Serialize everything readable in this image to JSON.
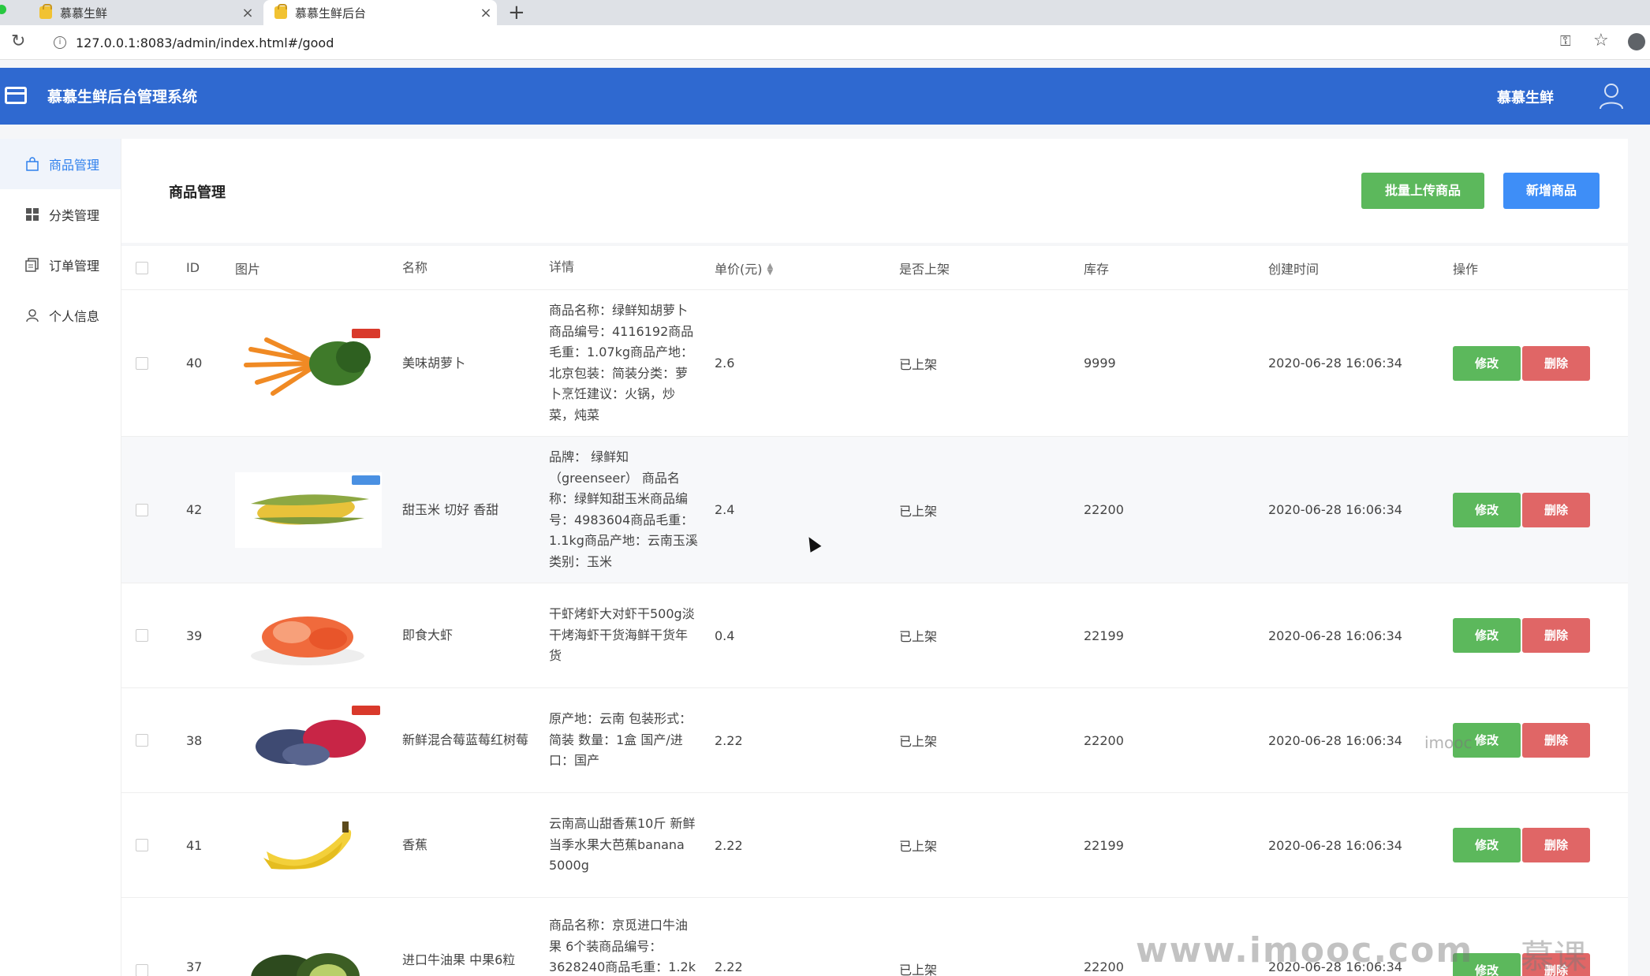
{
  "browser": {
    "tabs": [
      {
        "title": "慕慕生鲜",
        "close": "×"
      },
      {
        "title": "慕慕生鲜后台",
        "close": "×"
      }
    ],
    "new_tab": "+",
    "url": "127.0.0.1:8083/admin/index.html#/good",
    "icons": [
      "reload-icon",
      "info-icon",
      "key-icon",
      "star-icon",
      "profile-icon"
    ]
  },
  "header": {
    "title": "慕慕生鲜后台管理系统",
    "user": "慕慕生鲜",
    "color": "#2f69d0"
  },
  "sidebar": {
    "items": [
      {
        "label": "商品管理",
        "icon": "bag-icon",
        "active": true
      },
      {
        "label": "分类管理",
        "icon": "grid-icon",
        "active": false
      },
      {
        "label": "订单管理",
        "icon": "order-icon",
        "active": false
      },
      {
        "label": "个人信息",
        "icon": "user-icon",
        "active": false
      }
    ]
  },
  "main": {
    "title": "商品管理",
    "batch_upload_label": "批量上传商品",
    "new_product_label": "新增商品"
  },
  "table": {
    "columns": [
      "ID",
      "图片",
      "名称",
      "详情",
      "单价(元)",
      "是否上架",
      "库存",
      "创建时间",
      "操作"
    ],
    "edit_label": "修改",
    "delete_label": "删除",
    "rows": [
      {
        "id": "40",
        "name": "美味胡萝卜",
        "detail": "商品名称：绿鲜知胡萝卜商品编号：4116192商品毛重：1.07kg商品产地：北京包装：简装分类：萝卜烹饪建议：火锅，炒菜，炖菜",
        "price": "2.6",
        "status": "已上架",
        "stock": "9999",
        "created": "2020-06-28 16:06:34",
        "image": "carrot"
      },
      {
        "id": "42",
        "name": "甜玉米 切好 香甜",
        "detail": "品牌： 绿鲜知（greenseer） 商品名称：绿鲜知甜玉米商品编号：4983604商品毛重：1.1kg商品产地：云南玉溪类别：玉米",
        "price": "2.4",
        "status": "已上架",
        "stock": "22200",
        "created": "2020-06-28 16:06:34",
        "image": "corn"
      },
      {
        "id": "39",
        "name": "即食大虾",
        "detail": "干虾烤虾大对虾干500g淡干烤海虾干货海鲜干货年货",
        "price": "0.4",
        "status": "已上架",
        "stock": "22199",
        "created": "2020-06-28 16:06:34",
        "image": "shrimp"
      },
      {
        "id": "38",
        "name": "新鲜混合莓蓝莓红树莓",
        "detail": "原产地：云南 包装形式：简装 数量：1盒 国产/进口：国产",
        "price": "2.22",
        "status": "已上架",
        "stock": "22200",
        "created": "2020-06-28 16:06:34",
        "image": "berries"
      },
      {
        "id": "41",
        "name": "香蕉",
        "detail": "云南高山甜香蕉10斤 新鲜当季水果大芭蕉banana 5000g",
        "price": "2.22",
        "status": "已上架",
        "stock": "22199",
        "created": "2020-06-28 16:06:34",
        "image": "banana"
      },
      {
        "id": "37",
        "name": "进口牛油果 中果6粒",
        "detail": "商品名称：京觅进口牛油果 6个装商品编号：3628240商品毛重：1.2k",
        "price": "2.22",
        "status": "已上架",
        "stock": "22200",
        "created": "2020-06-28 16:06:34",
        "image": "avocado"
      }
    ]
  },
  "watermark": {
    "site": "www.imooc.com",
    "brand": "慕课",
    "small": "imooc"
  }
}
